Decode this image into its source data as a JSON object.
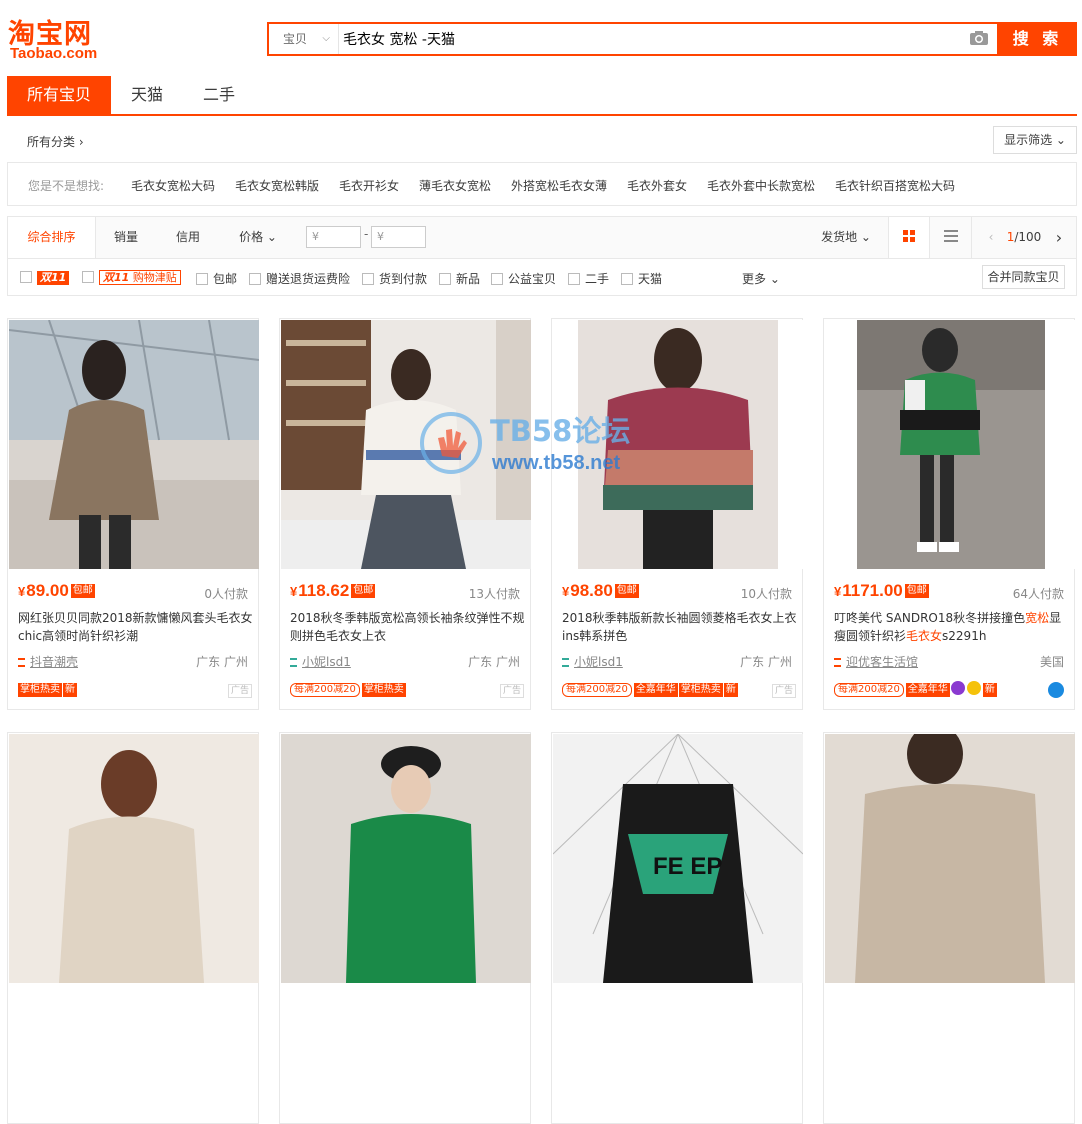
{
  "brand": {
    "logo_cn": "淘宝网",
    "logo_en": "Taobao.com",
    "accent": "#ff4400"
  },
  "search": {
    "category": "宝贝",
    "query": "毛衣女 宽松 -天猫",
    "button": "搜 索"
  },
  "tabs": [
    "所有宝贝",
    "天猫",
    "二手"
  ],
  "crumb": {
    "label": "所有分类 ›",
    "filter": "显示筛选 ⌄"
  },
  "suggest": {
    "label": "您是不是想找:",
    "items": [
      "毛衣女宽松大码",
      "毛衣女宽松韩版",
      "毛衣开衫女",
      "薄毛衣女宽松",
      "外搭宽松毛衣女薄",
      "毛衣外套女",
      "毛衣外套中长款宽松",
      "毛衣针织百搭宽松大码"
    ]
  },
  "sort": {
    "items": [
      "综合排序",
      "销量",
      "信用",
      "价格 ⌄"
    ],
    "price_from": "¥",
    "price_to": "¥",
    "ship": "发货地 ⌄",
    "page": "1/100",
    "page_current": "1",
    "page_total": "/100"
  },
  "checks": {
    "d11": "双11",
    "d11b": "双11",
    "d11b_txt": "购物津贴",
    "items": [
      "包邮",
      "赠送退货运费险",
      "货到付款",
      "新品",
      "公益宝贝",
      "二手",
      "天猫"
    ],
    "more": "更多 ⌄",
    "merge": "合并同款宝贝"
  },
  "products": [
    {
      "price": "89.00",
      "baoyou": "包邮",
      "deals": "0人付款",
      "title": "网红张贝贝同款2018新款慵懒风套头毛衣女chic高领时尚针织衫潮",
      "shop": "抖音潮壳",
      "loc": "广东 广州",
      "badges": [
        "掌柜热卖",
        "新"
      ],
      "ad": "广告"
    },
    {
      "price": "118.62",
      "baoyou": "包邮",
      "deals": "13人付款",
      "title": "2018秋冬季韩版宽松高领长袖条纹弹性不规则拼色毛衣女上衣",
      "shop": "小妮lsd1",
      "loc": "广东 广州",
      "badges": [
        "每满200减20",
        "掌柜热卖"
      ],
      "ad": "广告"
    },
    {
      "price": "98.80",
      "baoyou": "包邮",
      "deals": "10人付款",
      "title": "2018秋季韩版新款长袖圆领菱格毛衣女上衣ins韩系拼色",
      "shop": "小妮lsd1",
      "loc": "广东 广州",
      "badges": [
        "每满200减20",
        "全嘉年华",
        "掌柜热卖",
        "新"
      ],
      "ad": "广告"
    },
    {
      "price": "1171.00",
      "baoyou": "包邮",
      "deals": "64人付款",
      "title_a": "叮咚美代 SANDRO18秋冬拼接撞色",
      "title_hl1": "宽松",
      "title_b": "显瘦圆领针织衫",
      "title_hl2": "毛衣女",
      "title_c": "s2291h",
      "shop": "迎优客生活馆",
      "loc": "美国",
      "badges": [
        "每满200减20",
        "全嘉年华",
        "新"
      ]
    }
  ],
  "watermark": {
    "text": "TB58论坛",
    "url": "www.tb58.net"
  }
}
